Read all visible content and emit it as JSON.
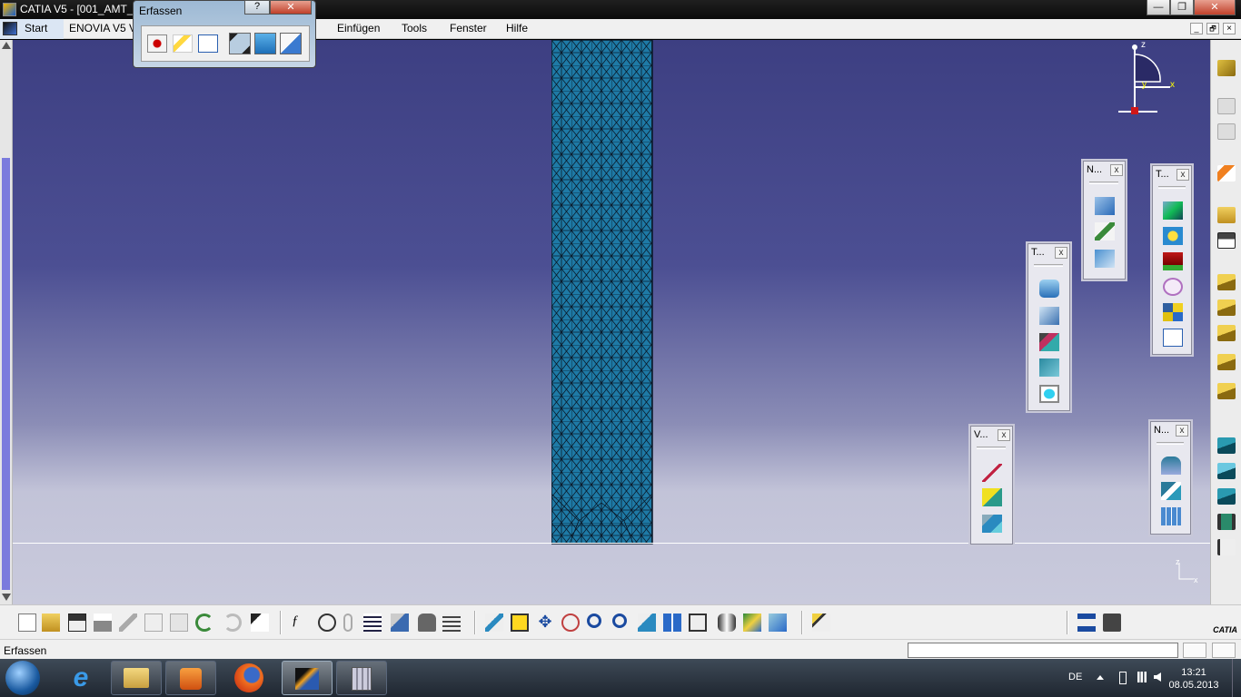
{
  "window": {
    "title": "CATIA V5 - [001_AMT_",
    "min": "—",
    "max": "❐",
    "close": "✕",
    "doc_min": "_",
    "doc_restore": "🗗",
    "doc_close": "×"
  },
  "menubar": {
    "items": [
      {
        "label": "Start"
      },
      {
        "label": "ENOVIA V5 V"
      },
      {
        "label": "Einfügen"
      },
      {
        "label": "Tools"
      },
      {
        "label": "Fenster"
      },
      {
        "label": "Hilfe"
      }
    ]
  },
  "capture_dialog": {
    "title": "Erfassen",
    "help": "?",
    "close": "✕",
    "tools": [
      "record-icon",
      "select-icon",
      "options-icon",
      "capture-icon",
      "image-icon",
      "settings-icon"
    ]
  },
  "palettes": {
    "n_top": {
      "title": "N...",
      "close": "x"
    },
    "t_right": {
      "title": "T...",
      "close": "x"
    },
    "t_mid": {
      "title": "T...",
      "close": "x"
    },
    "v_bottom": {
      "title": "V...",
      "close": "x"
    },
    "n_bottom": {
      "title": "N...",
      "close": "x"
    }
  },
  "compass": {
    "z": "z",
    "x": "x",
    "y": "y"
  },
  "axis_indicator": {
    "z": "z",
    "x": "x"
  },
  "brand": "CATIA",
  "statusbar": {
    "message": "Erfassen",
    "command_value": ""
  },
  "taskbar": {
    "language": "DE",
    "time": "13:21",
    "date": "08.05.2013"
  },
  "colors": {
    "mesh_fill": "#1e7aa6",
    "mesh_line": "#0a1a2a",
    "viewport_top": "#3d3f82",
    "viewport_bottom": "#c9cadc"
  }
}
